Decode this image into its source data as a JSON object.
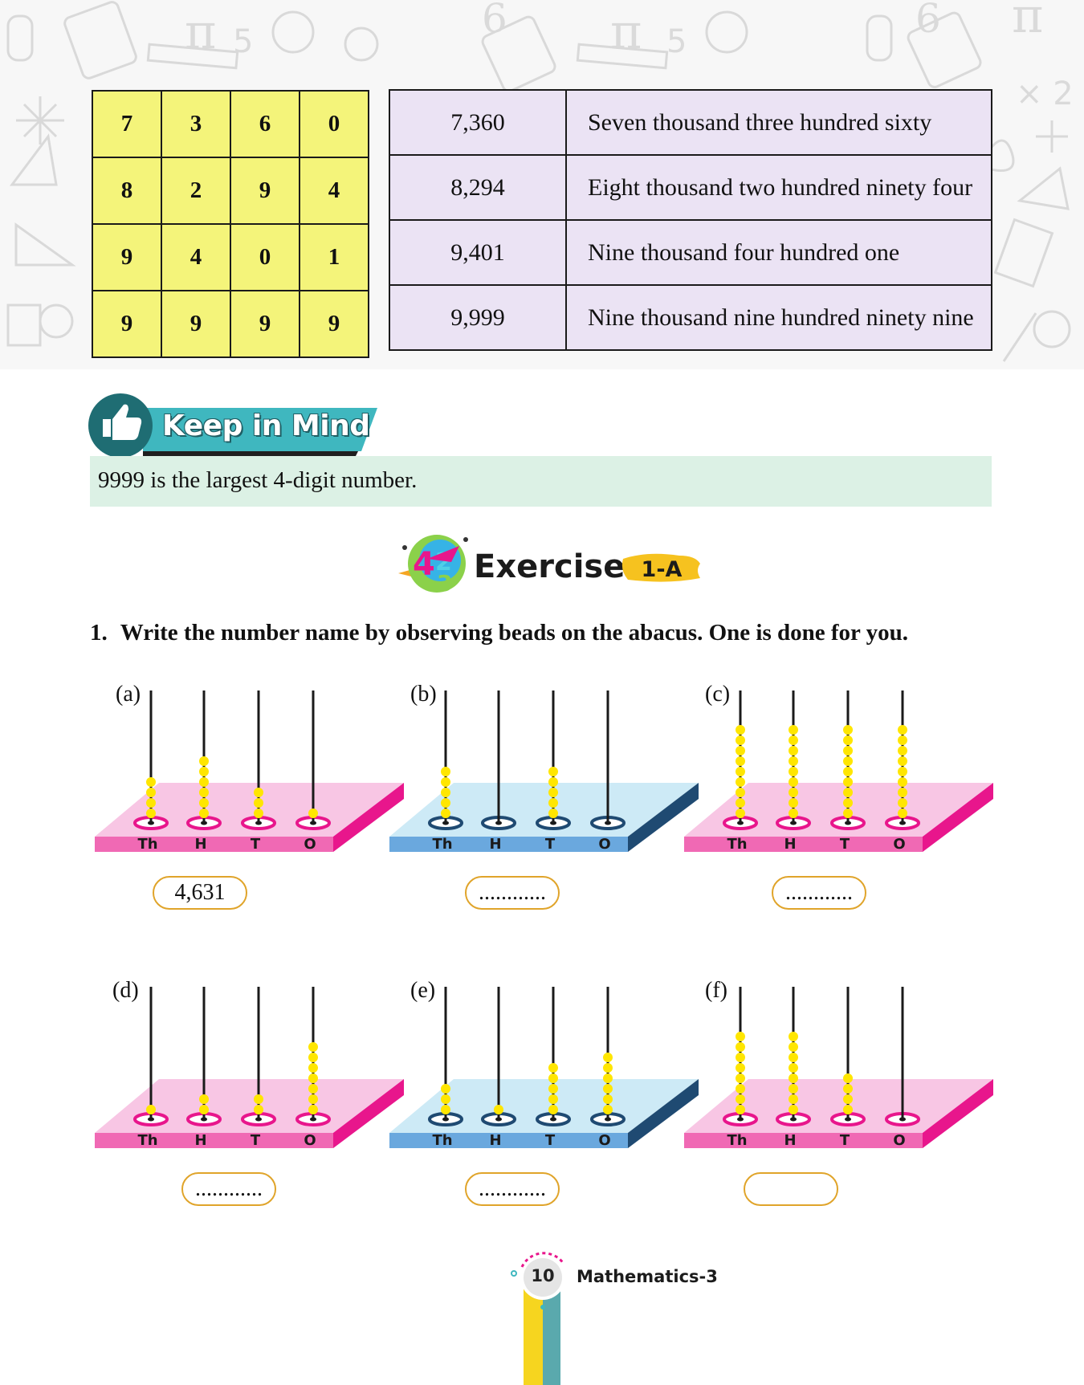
{
  "digit_grid": {
    "rows": [
      [
        "7",
        "3",
        "6",
        "0"
      ],
      [
        "8",
        "2",
        "9",
        "4"
      ],
      [
        "9",
        "4",
        "0",
        "1"
      ],
      [
        "9",
        "9",
        "9",
        "9"
      ]
    ]
  },
  "number_names": {
    "rows": [
      {
        "number": "7,360",
        "name": "Seven thousand three hundred sixty"
      },
      {
        "number": "8,294",
        "name": "Eight thousand two hundred ninety four"
      },
      {
        "number": "9,401",
        "name": "Nine thousand four hundred one"
      },
      {
        "number": "9,999",
        "name": "Nine thousand nine hundred ninety nine"
      }
    ]
  },
  "keep_in_mind": {
    "title": "Keep in Mind",
    "text": "9999 is the largest 4-digit number."
  },
  "exercise": {
    "title": "Exercise",
    "tag": "1-A"
  },
  "question": {
    "number": "1.",
    "text": "Write the number name by observing beads on the abacus. One is done for you."
  },
  "place_labels": [
    "Th",
    "H",
    "T",
    "O"
  ],
  "abaci": [
    {
      "label": "(a)",
      "beads": [
        4,
        6,
        3,
        1
      ],
      "answer": "4,631",
      "theme": "pink"
    },
    {
      "label": "(b)",
      "beads": [
        5,
        0,
        5,
        0
      ],
      "answer": "............",
      "theme": "blue"
    },
    {
      "label": "(c)",
      "beads": [
        9,
        9,
        9,
        9
      ],
      "answer": "............",
      "theme": "pink"
    },
    {
      "label": "(d)",
      "beads": [
        1,
        2,
        2,
        7
      ],
      "answer": "............",
      "theme": "pink"
    },
    {
      "label": "(e)",
      "beads": [
        3,
        1,
        5,
        6
      ],
      "answer": "............",
      "theme": "blue"
    },
    {
      "label": "(f)",
      "beads": [
        8,
        8,
        4,
        0
      ],
      "answer": "",
      "theme": "pink"
    }
  ],
  "colors": {
    "grid_fill": "#f4f47a",
    "names_fill": "#ebe3f4",
    "keep_box": "#dcf1e5",
    "bead": "#ffe600",
    "pink_top": "#f8c6e4",
    "pink_front": "#f069b4",
    "pink_side": "#e8168c",
    "blue_top": "#cdeaf6",
    "blue_front": "#6aa8de",
    "blue_side": "#1f4a72"
  },
  "footer": {
    "page_number": "10",
    "book_title": "Mathematics-3"
  }
}
